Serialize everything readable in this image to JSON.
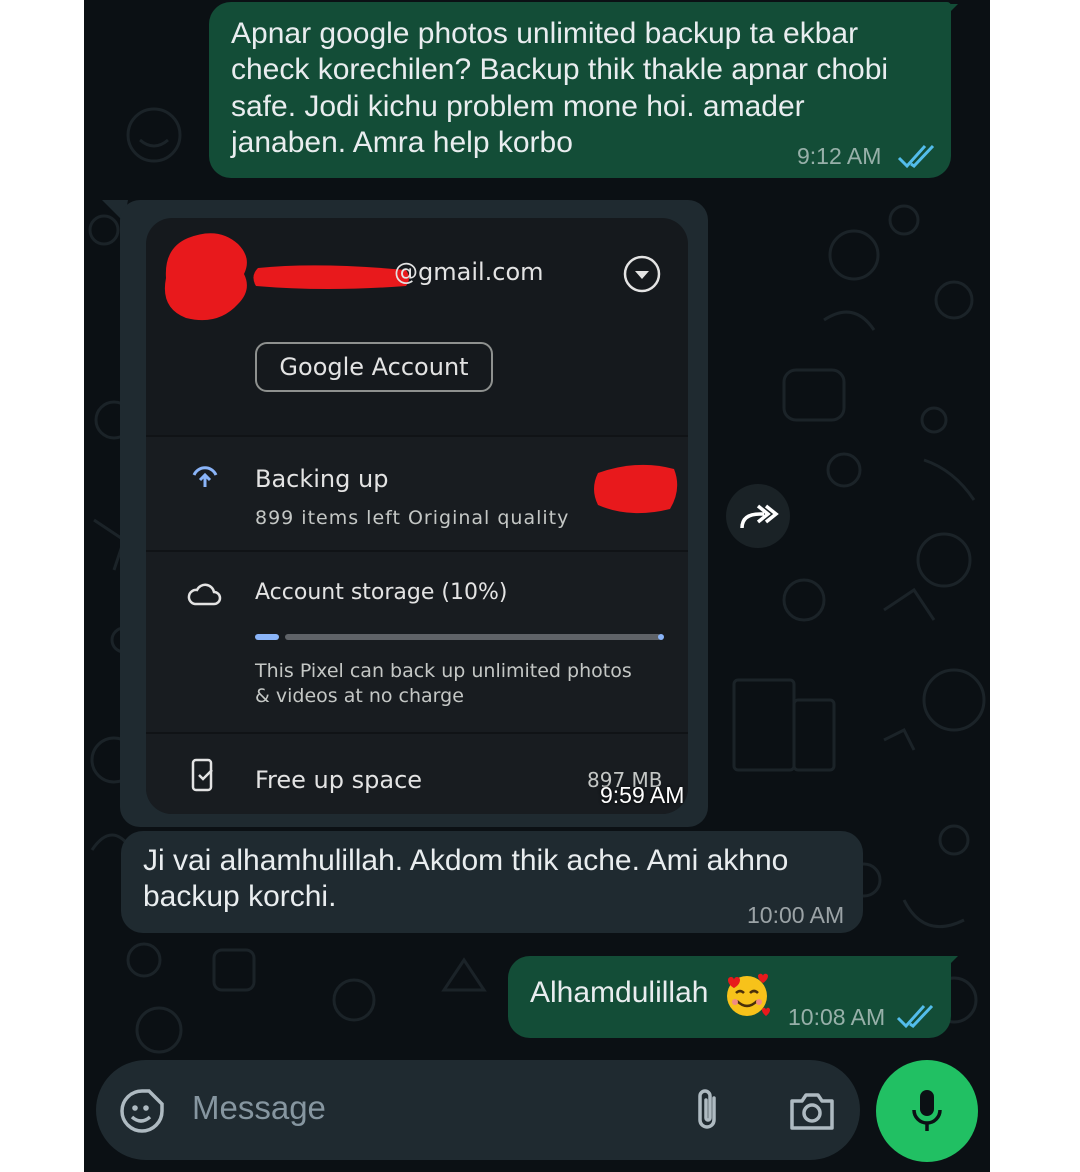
{
  "messages": {
    "m1": {
      "lines": [
        "Apnar google photos unlimited backup ta ekbar",
        "check korechilen? Backup thik thakle apnar chobi",
        "safe. Jodi kichu problem mone hoi. amader",
        "janaben. Amra help korbo"
      ],
      "time": "9:12 AM",
      "status": "read"
    },
    "m2": {
      "time": "9:59 AM",
      "screenshot": {
        "email": "@gmail.com",
        "account_button": "Google Account",
        "backing_up_title": "Backing up",
        "backing_up_subtitle": "899 items left Original quality",
        "storage_title": "Account storage (10%)",
        "storage_progress": 0.1,
        "storage_note_line1": "This Pixel can back up unlimited photos",
        "storage_note_line2": "& videos at no charge",
        "free_up_title": "Free up space",
        "free_up_size": "897 MB"
      }
    },
    "m3": {
      "lines": [
        "Ji vai alhamhulillah. Akdom thik ache. Ami akhno",
        "backup korchi."
      ],
      "time": "10:00 AM"
    },
    "m4": {
      "text": "Alhamdulillah",
      "emoji": "smiling-face-with-hearts",
      "time": "10:08 AM",
      "status": "read"
    }
  },
  "composer": {
    "placeholder": "Message"
  },
  "colors": {
    "chat_bg": "#0b1014",
    "outgoing_bubble": "#134d37",
    "incoming_bubble": "#1f2a30",
    "read_ticks": "#53bdeb",
    "mic_button": "#21c063",
    "redaction": "#e8191c"
  }
}
